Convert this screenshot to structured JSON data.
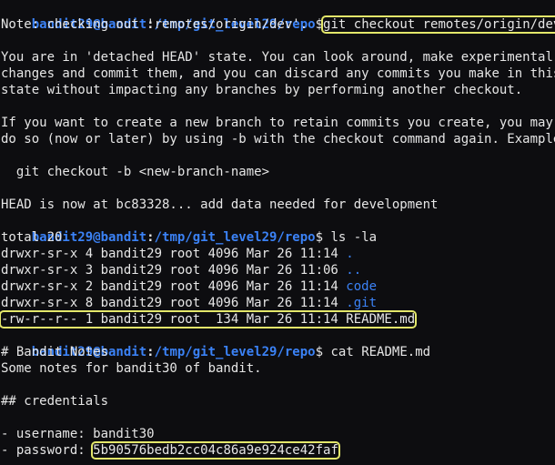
{
  "prompt": {
    "user_host": "bandit29@bandit",
    "colon": ":",
    "path": "/tmp/git_level29/repo",
    "dollar": "$"
  },
  "commands": {
    "checkout": "git checkout remotes/origin/dev",
    "ls": "ls -la",
    "cat": "cat README.md"
  },
  "output": {
    "note": "Note: checking out 'remotes/origin/dev'.",
    "detached_1": "You are in 'detached HEAD' state. You can look around, make experimental",
    "detached_2": "changes and commit them, and you can discard any commits you make in this",
    "detached_3": "state without impacting any branches by performing another checkout.",
    "branch_1": "If you want to create a new branch to retain commits you create, you may",
    "branch_2": "do so (now or later) by using -b with the checkout command again. Example:",
    "example": "  git checkout -b <new-branch-name>",
    "head": "HEAD is now at bc83328... add data needed for development",
    "total": "total 20",
    "ls_rows": [
      {
        "meta": "drwxr-sr-x 4 bandit29 root 4096 Mar 26 11:14 ",
        "name": "."
      },
      {
        "meta": "drwxr-sr-x 3 bandit29 root 4096 Mar 26 11:06 ",
        "name": ".."
      },
      {
        "meta": "drwxr-sr-x 2 bandit29 root 4096 Mar 26 11:14 ",
        "name": "code"
      },
      {
        "meta": "drwxr-sr-x 8 bandit29 root 4096 Mar 26 11:14 ",
        "name": ".git"
      }
    ],
    "readme_row": "-rw-r--r-- 1 bandit29 root  134 Mar 26 11:14 README.md",
    "readme_title": "# Bandit Notes",
    "readme_desc": "Some notes for bandit30 of bandit.",
    "readme_heading": "## credentials",
    "username_line": "- username: bandit30",
    "password_label": "- password: ",
    "password_value": "5b90576bedb2cc04c86a9e924ce42faf"
  },
  "colors": {
    "background": "#0d0d10",
    "text": "#e6e6e6",
    "prompt_blue": "#3b82f6",
    "highlight": "#e3e76a"
  }
}
